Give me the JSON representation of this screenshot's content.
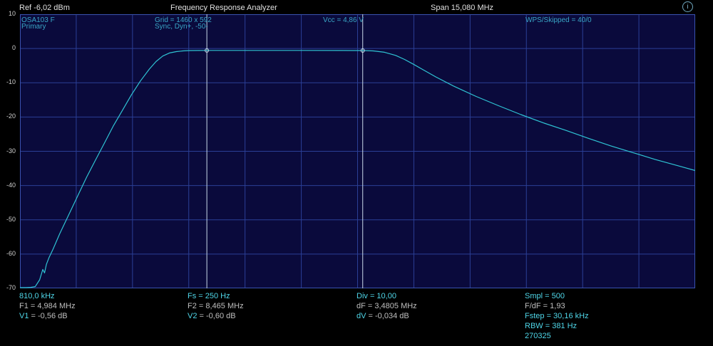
{
  "header": {
    "ref": "Ref  -6,02 dBm",
    "title": "Frequency Response Analyzer",
    "span": "Span 15,080 MHz",
    "help_glyph": "i"
  },
  "info": {
    "device": "OSA103 F",
    "channel": "Primary",
    "grid": "Grid = 1460 x 592",
    "sync": "Sync,  Dyn+,  -50-",
    "vcc": "Vcc = 4,86 V",
    "wps": "WPS/Skipped  = 40/0"
  },
  "footer": {
    "col1": {
      "start": "810,0 kHz",
      "f1": "F1 = 4,984 MHz",
      "v1_label": "V1",
      "v1_value": " = -0,56 dB"
    },
    "col2": {
      "fs": "Fs = 250 Hz",
      "f2": "F2 = 8,465 MHz",
      "v2_label": "V2",
      "v2_value": " = -0,60 dB"
    },
    "col3": {
      "div": "Div = 10,00",
      "df": "dF = 3,4805 MHz",
      "dv_label": "dV",
      "dv_value": " = -0,034 dB"
    },
    "col4": {
      "smpl": "Smpl = 500",
      "fdf": "F/dF = 1,93",
      "fstep": "Fstep = 30,16 kHz",
      "rbw": "RBW = 381 Hz",
      "date": "270325"
    }
  },
  "chart_data": {
    "type": "line",
    "title": "",
    "xlabel": "",
    "ylabel": "",
    "x_unit": "MHz",
    "xlim": [
      0.81,
      15.89
    ],
    "ylim": [
      -70,
      10
    ],
    "y_ticks": [
      10,
      0,
      -10,
      -20,
      -30,
      -40,
      -50,
      -60,
      -70
    ],
    "x_divisions": 12,
    "grid": true,
    "colors": {
      "trace": "#2fc4d4",
      "grid": "#2b3f96",
      "background": "#0a0a3c",
      "marker": "#c8d8e8"
    },
    "series": [
      {
        "values_x": [
          0.81,
          0.95,
          1.05,
          1.15,
          1.25,
          1.32,
          1.36,
          1.4,
          1.46,
          1.55,
          1.7,
          1.9,
          2.1,
          2.3,
          2.5,
          2.7,
          2.9,
          3.1,
          3.3,
          3.5,
          3.7,
          3.85,
          4.0,
          4.15,
          4.3,
          4.45,
          4.6,
          4.8,
          4.98,
          5.2,
          6.0,
          7.0,
          8.0,
          8.47,
          8.7,
          8.95,
          9.2,
          9.4,
          9.6,
          9.8,
          10.1,
          10.5,
          11.0,
          11.5,
          12.0,
          12.5,
          13.0,
          13.5,
          14.0,
          14.5,
          15.0,
          15.5,
          15.89
        ],
        "values_y": [
          -69.8,
          -69.8,
          -69.7,
          -69.5,
          -67.5,
          -64.5,
          -65.5,
          -63.0,
          -61.0,
          -58.5,
          -54.0,
          -48.5,
          -43.0,
          -37.5,
          -32.5,
          -27.5,
          -22.5,
          -18.0,
          -13.5,
          -9.5,
          -6.0,
          -3.8,
          -2.2,
          -1.3,
          -0.9,
          -0.7,
          -0.6,
          -0.57,
          -0.56,
          -0.55,
          -0.55,
          -0.56,
          -0.58,
          -0.6,
          -0.7,
          -1.1,
          -2.0,
          -3.2,
          -4.6,
          -6.1,
          -8.3,
          -11.0,
          -14.0,
          -16.7,
          -19.3,
          -21.7,
          -23.9,
          -26.2,
          -28.4,
          -30.4,
          -32.4,
          -34.2,
          -35.6
        ]
      }
    ],
    "markers": [
      {
        "label": "F1",
        "x": 4.984,
        "y": -0.56
      },
      {
        "label": "F2",
        "x": 8.465,
        "y": -0.6
      }
    ]
  }
}
